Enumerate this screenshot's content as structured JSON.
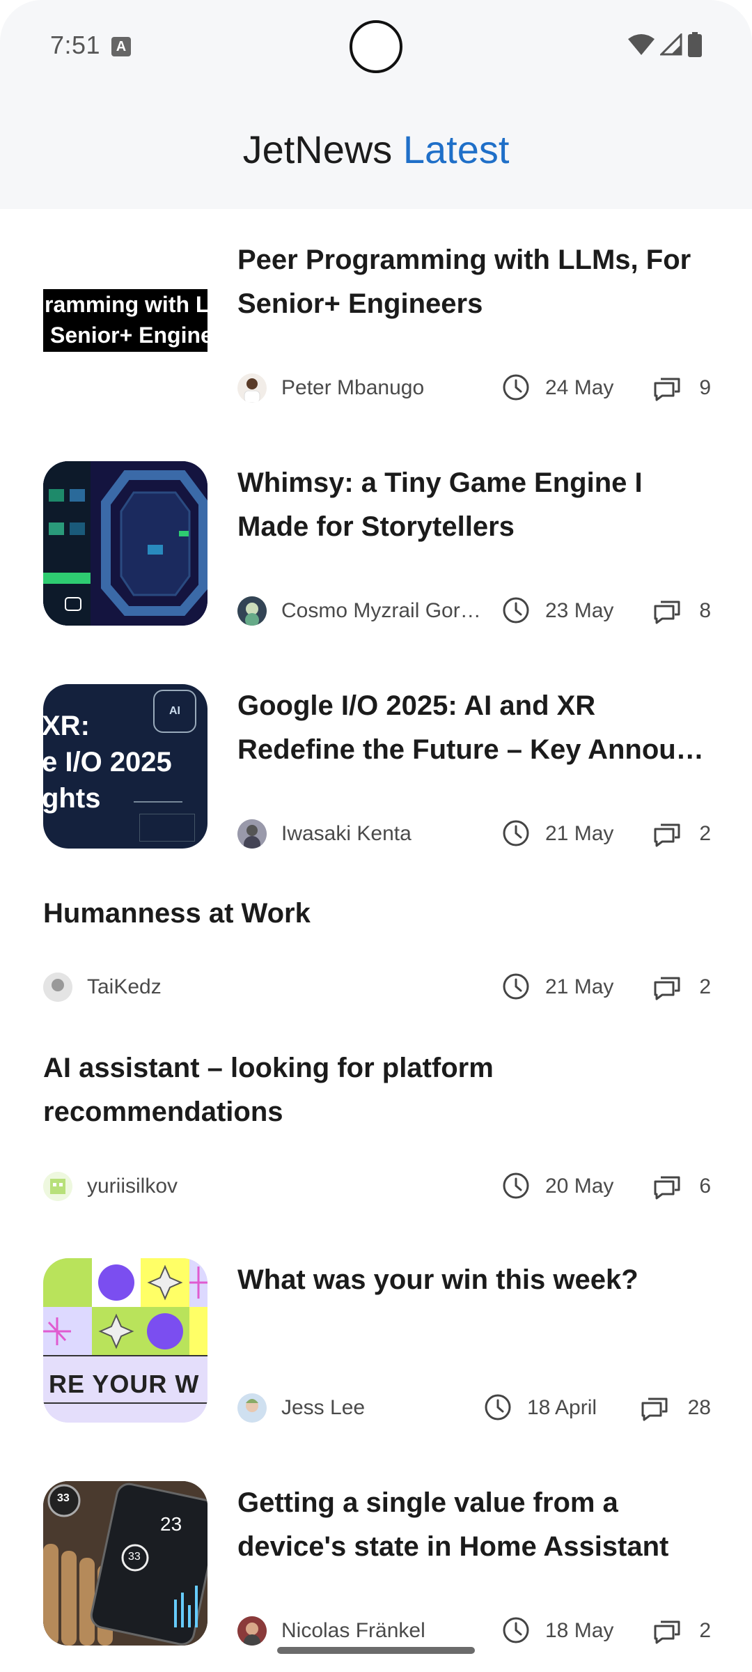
{
  "status_bar": {
    "time": "7:51",
    "notification_icon": "keyboard-a-icon"
  },
  "app_title": {
    "brand": "JetNews",
    "section": "Latest"
  },
  "colors": {
    "accent": "#1f6fc8",
    "header_bg": "#f6f7f9"
  },
  "articles": [
    {
      "title": "Peer Programming with LLMs, For Senior+ Engineers",
      "thumbnail_text": [
        "ramming with L",
        "Senior+ Engine"
      ],
      "author": "Peter Mbanugo",
      "date": "24 May",
      "comments": "9"
    },
    {
      "title": "Whimsy: a Tiny Game Engine I Made for Storytellers",
      "author": "Cosmo Myzrail Gory…",
      "date": "23 May",
      "comments": "8"
    },
    {
      "title": "Google I/O 2025: AI and XR Redefine the Future – Key Annou…",
      "thumbnail_text": [
        "XR:",
        "e I/O 2025",
        "ghts",
        "AI"
      ],
      "author": "Iwasaki Kenta",
      "date": "21 May",
      "comments": "2"
    },
    {
      "title": "Humanness at Work",
      "author": "TaiKedz",
      "date": "21 May",
      "comments": "2"
    },
    {
      "title": "AI assistant – looking for platform recommendations",
      "author": "yuriisilkov",
      "date": "20 May",
      "comments": "6"
    },
    {
      "title": "What was your win this week?",
      "thumbnail_text": [
        "RE YOUR W"
      ],
      "author": "Jess Lee",
      "date": "18 April",
      "comments": "28"
    },
    {
      "title": "Getting a single value from a device's state in Home Assistant",
      "thumbnail_text": [
        "33",
        "23",
        "33"
      ],
      "author": "Nicolas Fränkel",
      "date": "18 May",
      "comments": "2"
    }
  ]
}
